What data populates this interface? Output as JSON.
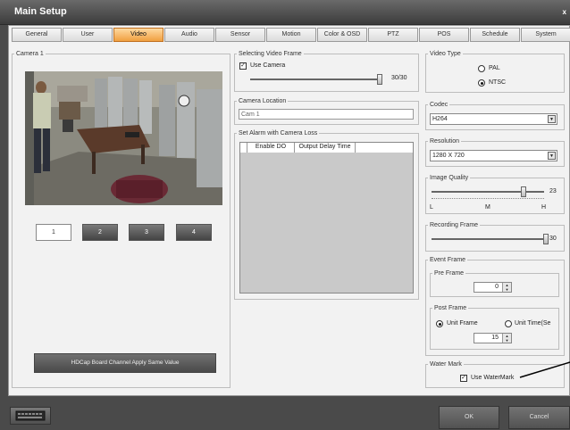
{
  "window": {
    "title": "Main Setup",
    "close_glyph": "x"
  },
  "tabs": [
    {
      "label": "General"
    },
    {
      "label": "User"
    },
    {
      "label": "Video"
    },
    {
      "label": "Audio"
    },
    {
      "label": "Sensor"
    },
    {
      "label": "Motion"
    },
    {
      "label": "Color & OSD"
    },
    {
      "label": "PTZ"
    },
    {
      "label": "POS"
    },
    {
      "label": "Schedule"
    },
    {
      "label": "System"
    }
  ],
  "active_tab": "Video",
  "camera": {
    "legend": "Camera 1",
    "channels": [
      "1",
      "2",
      "3",
      "4"
    ],
    "active_channel": "1",
    "apply_label": "HDCap Board Channel Apply Same Value"
  },
  "frame": {
    "legend": "Selecting Video Frame",
    "use_camera_label": "Use Camera",
    "use_camera_checked": true,
    "value_text": "30/30",
    "slider_fraction": 1.0
  },
  "location": {
    "legend": "Camera Location",
    "value": "Cam 1"
  },
  "alarm": {
    "legend": "Set Alarm with Camera Loss",
    "columns": [
      "Enable DO",
      "Output Delay Time"
    ]
  },
  "video_type": {
    "legend": "Video Type",
    "options": [
      "PAL",
      "NTSC"
    ],
    "selected": "NTSC"
  },
  "codec": {
    "legend": "Codec",
    "value": "H264"
  },
  "resolution": {
    "legend": "Resolution",
    "value": "1280 X  720"
  },
  "quality": {
    "legend": "Image Quality",
    "value": "23",
    "marks": [
      "L",
      "M",
      "H"
    ],
    "slider_fraction": 0.82
  },
  "recording": {
    "legend": "Recording Frame",
    "value": "30",
    "slider_fraction": 1.0
  },
  "event": {
    "legend": "Event Frame",
    "pre_legend": "Pre Frame",
    "pre_value": "0",
    "post_legend": "Post Frame",
    "unit_frame": "Unit Frame",
    "unit_time": "Unit Time(Se",
    "post_selected": "Unit Frame",
    "post_value": "15"
  },
  "watermark": {
    "legend": "Water Mark",
    "label": "Use WaterMark",
    "checked": true
  },
  "footer": {
    "ok": "OK",
    "cancel": "Cancel",
    "keyboard_icon": "keyboard-icon"
  }
}
